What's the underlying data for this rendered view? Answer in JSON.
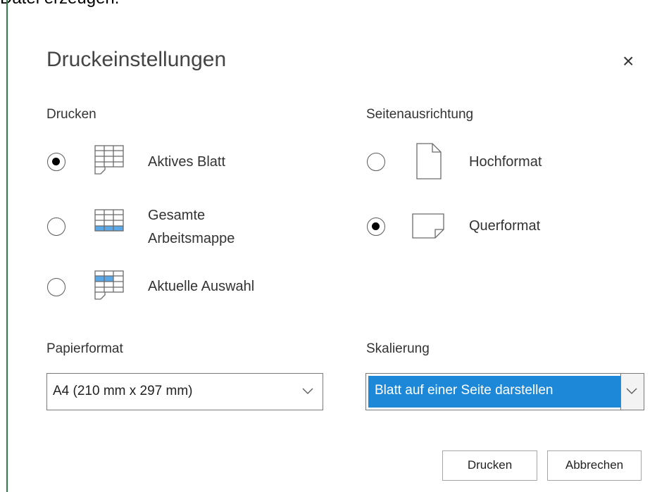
{
  "background_text": "Datei erzeugen.",
  "dialog": {
    "title": "Druckeinstellungen",
    "close_label": "×"
  },
  "print_section": {
    "label": "Drucken",
    "options": [
      {
        "label": "Aktives Blatt",
        "checked": true
      },
      {
        "label_line1": "Gesamte",
        "label_line2": "Arbeitsmappe",
        "checked": false
      },
      {
        "label": "Aktuelle Auswahl",
        "checked": false
      }
    ]
  },
  "orientation_section": {
    "label": "Seitenausrichtung",
    "options": [
      {
        "label": "Hochformat",
        "checked": false
      },
      {
        "label": "Querformat",
        "checked": true
      }
    ]
  },
  "paper_section": {
    "label": "Papierformat",
    "selected": "A4 (210 mm x 297 mm)"
  },
  "scaling_section": {
    "label": "Skalierung",
    "selected": "Blatt auf einer Seite darstellen"
  },
  "buttons": {
    "print": "Drucken",
    "cancel": "Abbrechen"
  },
  "colors": {
    "accent": "#1e88d8",
    "selection_fill": "#5aa8e8",
    "sheet_border": "#2e7d4a"
  }
}
